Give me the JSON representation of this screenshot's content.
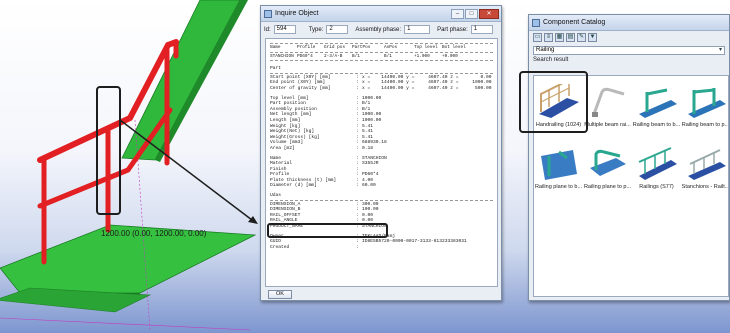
{
  "viewport": {
    "dimension_label": "1200.00 (0.00, 1200.00, 0.00)"
  },
  "inquire": {
    "title": "Inquire Object",
    "id_label": "Id:",
    "id_value": "594",
    "type_label": "Type:",
    "type_value": "2",
    "assembly_label": "Assembly phase:",
    "assembly_value": "1",
    "part_label": "Part phase:",
    "part_value": "1",
    "headers": [
      "Name",
      "Profile",
      "Grid pos",
      "PartPos",
      "AsPos",
      "Top level",
      "Bot level"
    ],
    "summary_row": [
      "STANCHION",
      "PD60*4",
      "2-3/A-B",
      "B/1",
      "B/1",
      "+1.000",
      "+0.000"
    ],
    "part_header": "Part",
    "coords": [
      {
        "k": "Start point (X0Y) [mm]",
        "v": "x =    14400.00 y =     4607.40 z =        0.00"
      },
      {
        "k": "End point (X0Y) [mm]",
        "v": "x =    14400.00 y =     4607.40 z =     1000.00"
      },
      {
        "k": "Center of gravity [mm]",
        "v": "x =    14400.00 y =     4607.40 z =      500.00"
      }
    ],
    "props1": [
      {
        "k": "Top level [mm]",
        "v": "1000.00"
      },
      {
        "k": "Part position",
        "v": "B/1"
      },
      {
        "k": "Assembly position",
        "v": "B/1"
      },
      {
        "k": "Net length [mm]",
        "v": "1000.00"
      },
      {
        "k": "Length [mm]",
        "v": "1000.00"
      },
      {
        "k": "Weight [kg]",
        "v": "5.41"
      },
      {
        "k": "Weight(Net) [kg]",
        "v": "5.41"
      },
      {
        "k": "Weight(Gross) [kg]",
        "v": "5.41"
      },
      {
        "k": "Volume [mm3]",
        "v": "688930.18"
      },
      {
        "k": "Area [m2]",
        "v": "0.18"
      }
    ],
    "props2": [
      {
        "k": "Name",
        "v": "STANCHION"
      },
      {
        "k": "Material",
        "v": "S355JR"
      },
      {
        "k": "Finish",
        "v": ""
      },
      {
        "k": "Profile",
        "v": "PD60*4"
      },
      {
        "k": "Plate thickness (t) [mm]",
        "v": "4.00"
      },
      {
        "k": "Diameter (d) [mm]",
        "v": "60.00"
      }
    ],
    "uda_header": "Udas",
    "props3": [
      {
        "k": "DIMENSION_A",
        "v": "300.00"
      },
      {
        "k": "DIMENSION_B",
        "v": "100.00"
      },
      {
        "k": "RAIL_OFFSET",
        "v": "0.00"
      },
      {
        "k": "RAIL_ANGLE",
        "v": "0.00"
      },
      {
        "k": "PRODUCT_NAME",
        "v": "STANCHION"
      }
    ],
    "props4": [
      {
        "k": "Owner",
        "v": "TEKLAAD/Pamj"
      },
      {
        "k": "GUID",
        "v": "ID8E5B5720-0000-0017-3133-613233383031"
      },
      {
        "k": "Created",
        "v": ""
      }
    ],
    "ok_label": "OK"
  },
  "catalog": {
    "title": "Component Catalog",
    "search_value": "Railing",
    "result_label": "Search result",
    "items": [
      {
        "label": "Handrailing (1024)",
        "icon": "handrailing-icon"
      },
      {
        "label": "Multiple beam rai...",
        "icon": "multiple-beam-railing-icon"
      },
      {
        "label": "Railing beam to b...",
        "icon": "railing-beam-icon"
      },
      {
        "label": "Railing beam to p...",
        "icon": "railing-beam-plate-icon"
      },
      {
        "label": "Railing plane to b...",
        "icon": "railing-plane-icon"
      },
      {
        "label": "Railing plane to p...",
        "icon": "railing-plane-plate-icon"
      },
      {
        "label": "Railings (S77)",
        "icon": "railings-icon"
      },
      {
        "label": "Stanchions - Railt...",
        "icon": "stanchions-icon"
      }
    ]
  },
  "colors": {
    "rail_red": "#e21f22",
    "beam_green": "#2fb83b",
    "highlight_black": "#1e1e1e"
  }
}
